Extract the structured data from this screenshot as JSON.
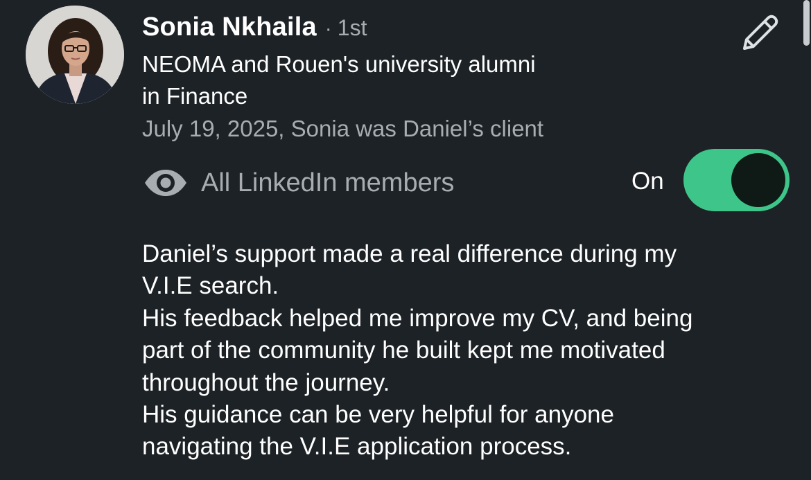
{
  "author": {
    "name": "Sonia Nkhaila",
    "separator": "·",
    "degree": "1st",
    "headline_lines": [
      "NEOMA and Rouen's university alumni",
      "in Finance"
    ],
    "relationship": "July 19, 2025, Sonia was Daniel’s client"
  },
  "visibility": {
    "icon": "eye-icon",
    "label": "All LinkedIn members",
    "toggle_label": "On",
    "toggle_on": true
  },
  "recommendation": {
    "lines": [
      "Daniel’s support made a real difference during my",
      "V.I.E search.",
      "His feedback helped me improve my CV, and being",
      "part of the community he built kept me motivated",
      "throughout the journey.",
      "His guidance can be very helpful for anyone",
      "navigating the V.I.E application process."
    ]
  },
  "actions": {
    "edit_icon": "pencil-icon"
  },
  "colors": {
    "background": "#1d2226",
    "text_primary": "#ffffff",
    "text_secondary": "#a8adb2",
    "toggle_track": "#3ec68a",
    "toggle_knob": "#0f1a16"
  }
}
